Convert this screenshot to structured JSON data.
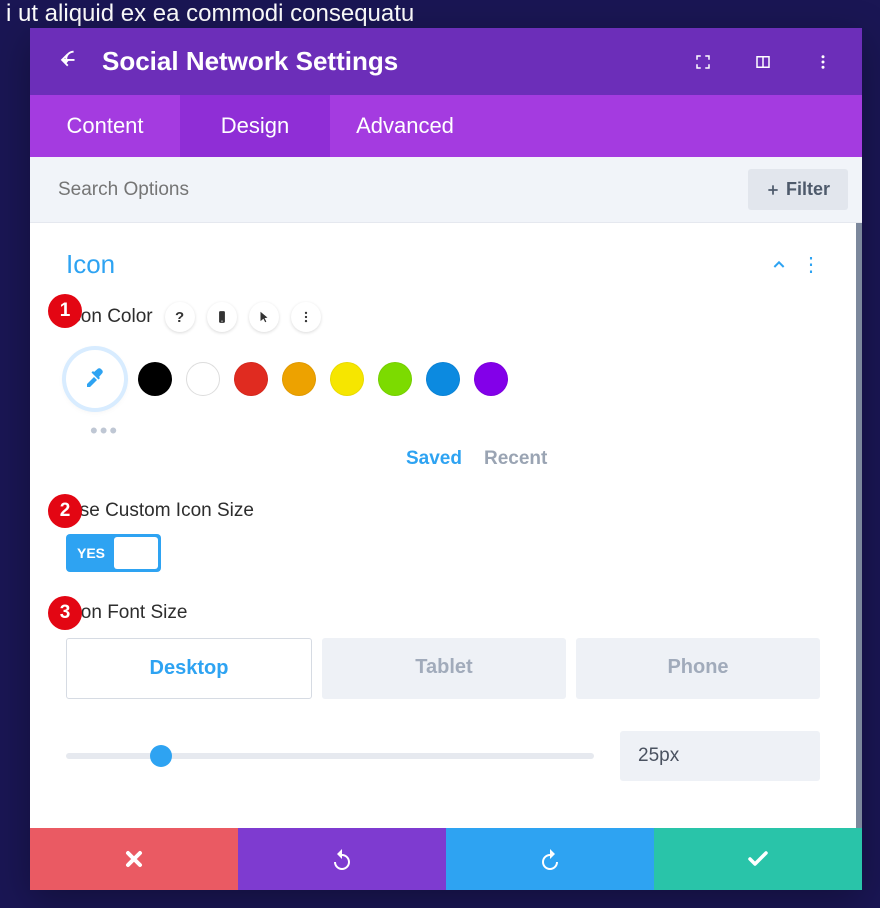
{
  "bg_text": "i ut aliquid ex ea commodi consequatu",
  "header": {
    "title": "Social Network Settings"
  },
  "tabs": {
    "content": "Content",
    "design": "Design",
    "advanced": "Advanced"
  },
  "search": {
    "placeholder": "Search Options",
    "filter": "Filter"
  },
  "section": {
    "title": "Icon"
  },
  "icon_color": {
    "label": "Icon Color",
    "swatches": [
      "#000000",
      "#ffffff",
      "#e02b20",
      "#eda200",
      "#f6e600",
      "#7cdb00",
      "#0c8ae0",
      "#8300e9"
    ],
    "saved": "Saved",
    "recent": "Recent"
  },
  "custom_size": {
    "label": "Use Custom Icon Size",
    "yes": "YES"
  },
  "font_size": {
    "label": "Icon Font Size",
    "devices": {
      "desktop": "Desktop",
      "tablet": "Tablet",
      "phone": "Phone"
    },
    "value": "25px"
  },
  "badges": {
    "b1": "1",
    "b2": "2",
    "b3": "3"
  }
}
